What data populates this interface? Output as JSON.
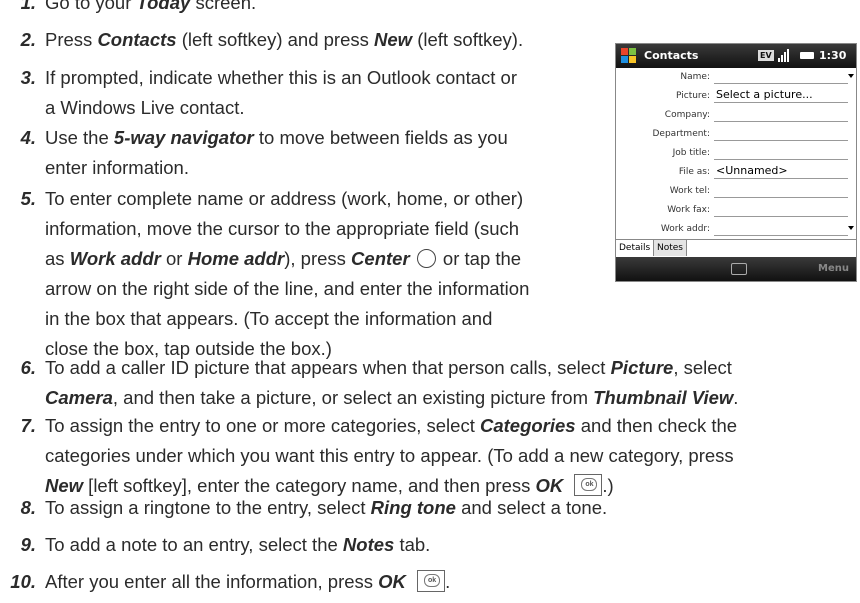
{
  "steps": [
    {
      "num": "1.",
      "lines": [
        [
          "Go to your ",
          "Today",
          " screen."
        ]
      ]
    },
    {
      "num": "2.",
      "lines": [
        [
          "Press ",
          "Contacts",
          " (left softkey) and press ",
          "New",
          " (left softkey)."
        ]
      ]
    },
    {
      "num": "3.",
      "lines": [
        [
          "If prompted, indicate whether this is an Outlook contact or"
        ],
        [
          "a Windows Live contact."
        ]
      ]
    },
    {
      "num": "4.",
      "lines": [
        [
          "Use the ",
          "5-way navigator",
          " to move between fields as you"
        ],
        [
          "enter information."
        ]
      ]
    },
    {
      "num": "5.",
      "lines": [
        [
          "To enter complete name or address (work, home, or other)"
        ],
        [
          "information, move the cursor to the appropriate field (such"
        ],
        [
          "as ",
          "Work addr",
          " or ",
          "Home addr",
          "), press ",
          "Center",
          " {circle} or tap the"
        ],
        [
          "arrow on the right side of the line, and enter the information"
        ],
        [
          "in the box that appears. (To accept the information and"
        ],
        [
          "close the box, tap outside the box.)"
        ]
      ]
    },
    {
      "num": "6.",
      "lines": [
        [
          "To add a caller ID picture that appears when that person calls, select ",
          "Picture",
          ", select"
        ],
        [
          "",
          "Camera",
          ", and then take a picture, or select an existing picture from ",
          "Thumbnail View",
          "."
        ]
      ]
    },
    {
      "num": "7.",
      "lines": [
        [
          "To assign the entry to one or more categories, select ",
          "Categories",
          " and then check the"
        ],
        [
          "categories under which you want this entry to appear. (To add a new category, press"
        ],
        [
          "",
          "New",
          " [left softkey], enter the category name, and then press ",
          "OK",
          " {ok}.)"
        ]
      ]
    },
    {
      "num": "8.",
      "lines": [
        [
          "To assign a ringtone to the entry, select ",
          "Ring tone",
          " and select a tone."
        ]
      ]
    },
    {
      "num": "9.",
      "lines": [
        [
          "To add a note to an entry, select the ",
          "Notes",
          " tab."
        ]
      ]
    },
    {
      "num": "10.",
      "lines": [
        [
          "After you enter all the information, press ",
          "OK",
          " {ok}."
        ]
      ]
    }
  ],
  "phone": {
    "title": "Contacts",
    "ev_badge": "EV",
    "time": "1:30",
    "fields": [
      {
        "label": "Name:",
        "value": "",
        "arrow": true
      },
      {
        "label": "Picture:",
        "value": "Select a picture...",
        "arrow": false
      },
      {
        "label": "Company:",
        "value": "",
        "arrow": false
      },
      {
        "label": "Department:",
        "value": "",
        "arrow": false
      },
      {
        "label": "Job title:",
        "value": "",
        "arrow": false
      },
      {
        "label": "File as:",
        "value": "<Unnamed>",
        "arrow": false
      },
      {
        "label": "Work tel:",
        "value": "",
        "arrow": false
      },
      {
        "label": "Work fax:",
        "value": "",
        "arrow": false
      },
      {
        "label": "Work addr:",
        "value": "",
        "arrow": true
      }
    ],
    "tabs": [
      "Details",
      "Notes"
    ],
    "right_softkey": "Menu"
  },
  "ok_button_label": "ok"
}
